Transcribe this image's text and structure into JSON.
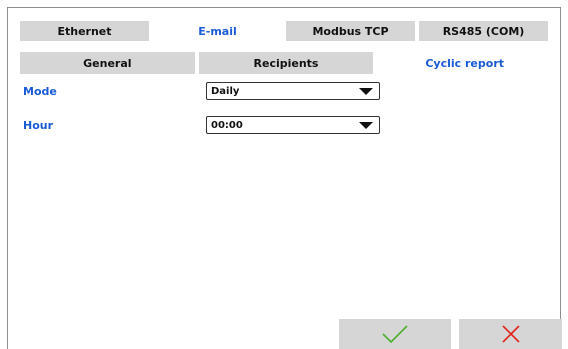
{
  "tabs": [
    {
      "label": "Ethernet",
      "active": false
    },
    {
      "label": "E-mail",
      "active": true
    },
    {
      "label": "Modbus TCP",
      "active": false
    },
    {
      "label": "RS485 (COM)",
      "active": false
    }
  ],
  "subtabs": [
    {
      "label": "General",
      "active": false
    },
    {
      "label": "Recipients",
      "active": false
    },
    {
      "label": "Cyclic report",
      "active": true
    }
  ],
  "form": {
    "mode_label": "Mode",
    "mode_value": "Daily",
    "hour_label": "Hour",
    "hour_value": "00:00"
  },
  "footer": {
    "ok_icon": "check-icon",
    "cancel_icon": "close-icon",
    "ok_color": "#4caf2e",
    "cancel_color": "#e2231a"
  },
  "colors": {
    "accent": "#1a5bd6",
    "tab_inactive": "#d6d6d6"
  }
}
